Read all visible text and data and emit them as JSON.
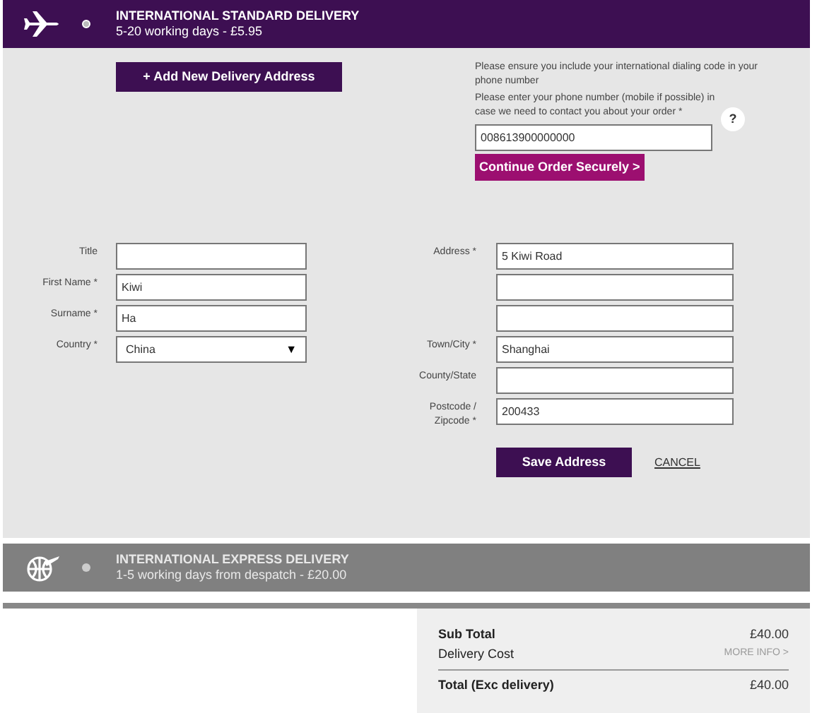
{
  "delivery_options": [
    {
      "kind": "plane",
      "title": "INTERNATIONAL STANDARD DELIVERY",
      "detail": "5-20 working days - £5.95",
      "selected": true
    },
    {
      "kind": "globe",
      "title": "INTERNATIONAL EXPRESS DELIVERY",
      "detail": "1-5 working days from despatch - £20.00",
      "selected": false
    }
  ],
  "add_address_button": "+ Add New Delivery Address",
  "phone": {
    "note": "Please ensure you include your international dialing code in your phone number",
    "prompt": "Please enter your phone number (mobile if possible) in case we need to contact you about your order *",
    "value": "008613900000000",
    "help": "?"
  },
  "continue_button": "Continue Order Securely >",
  "left_fields": [
    {
      "kind": "text",
      "label": "Title"
    },
    {
      "kind": "text",
      "label": "First Name *",
      "value": "Kiwi"
    },
    {
      "kind": "text",
      "label": "Surname *",
      "value": "Ha"
    },
    {
      "kind": "select",
      "label": "Country *",
      "value": "China",
      "caret": "▼"
    }
  ],
  "right_fields": [
    {
      "kind": "text",
      "label": "Address *",
      "value": "5 Kiwi Road"
    },
    {
      "kind": "text"
    },
    {
      "kind": "text"
    },
    {
      "kind": "text",
      "label": "Town/City *",
      "value": "Shanghai"
    },
    {
      "kind": "text",
      "label": "County/State"
    },
    {
      "kind": "text",
      "label": "Postcode / Zipcode *",
      "value": "200433"
    }
  ],
  "save_button": "Save Address",
  "cancel_link": "CANCEL",
  "summary": {
    "rows": [
      {
        "kind": "subtotal",
        "label": "Sub Total",
        "value": "£40.00"
      },
      {
        "kind": "delivery",
        "label": "Delivery Cost",
        "value": "MORE INFO >"
      },
      {
        "kind": "total",
        "label": "Total (Exc delivery)",
        "value": "£40.00"
      }
    ]
  }
}
